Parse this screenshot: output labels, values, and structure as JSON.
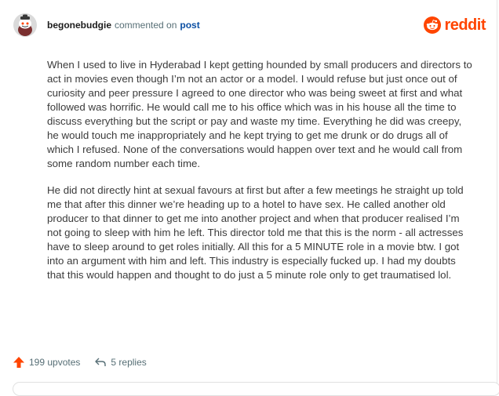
{
  "header": {
    "username": "begonebudgie",
    "action_text": "commented on",
    "post_link": "post",
    "brand": "reddit",
    "avatar_icon": "snoo-avatar-icon",
    "brand_icon": "reddit-logo-icon",
    "brand_color": "#ff4500"
  },
  "comment": {
    "paragraphs": [
      "When I used to live in Hyderabad I kept getting hounded by small producers and directors to act in movies even though I’m not an actor or a model. I would refuse but just once out of curiosity and peer pressure I agreed to one director who was being sweet at first and what followed was horrific. He would call me to his office which was in his house all the time to discuss everything but the script or pay and waste my time. Everything he did was creepy, he would touch me inappropriately and he kept trying to get me drunk or do drugs all of which I refused. None of the conversations would happen over text and he would call from some random number each time.",
      "He did not directly hint at sexual favours at first but after a few meetings he straight up told me that after this dinner we’re heading up to a hotel to have sex. He called another old producer to that dinner to get me into another project and when that producer realised I’m not going to sleep with him he left. This director told me that this is the norm - all actresses have to sleep around to get roles initially. All this for a 5 MINUTE role in a movie btw. I got into an argument with him and left. This industry is especially fucked up. I had my doubts that this would happen and thought to do just a 5 minute role only to get traumatised lol."
    ]
  },
  "footer": {
    "upvotes": "199 upvotes",
    "replies": "5 replies",
    "upvote_icon": "upvote-arrow-icon",
    "reply_icon": "reply-arrow-icon",
    "upvote_color": "#ff4500"
  }
}
